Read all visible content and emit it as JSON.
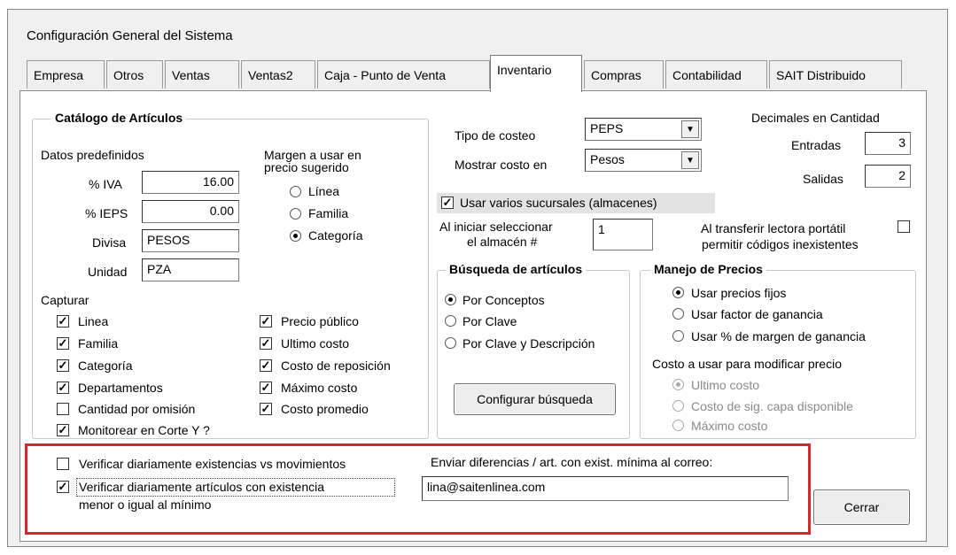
{
  "window": {
    "title": "Configuración General del Sistema"
  },
  "tabs": [
    {
      "label": "Empresa"
    },
    {
      "label": "Otros"
    },
    {
      "label": "Ventas"
    },
    {
      "label": "Ventas2"
    },
    {
      "label": "Caja - Punto de Venta"
    },
    {
      "label": "Inventario"
    },
    {
      "label": "Compras"
    },
    {
      "label": "Contabilidad"
    },
    {
      "label": "SAIT Distribuido"
    }
  ],
  "catalogo": {
    "title": "Catálogo de Artículos",
    "predef_title": "Datos predefinidos",
    "iva_label": "% IVA",
    "iva_value": "16.00",
    "ieps_label": "% IEPS",
    "ieps_value": "0.00",
    "divisa_label": "Divisa",
    "divisa_value": "PESOS",
    "unidad_label": "Unidad",
    "unidad_value": "PZA",
    "margen_title_1": "Margen a usar en",
    "margen_title_2": "precio sugerido",
    "margen_options": [
      {
        "label": "Línea",
        "checked": false
      },
      {
        "label": "Familia",
        "checked": false
      },
      {
        "label": "Categoría",
        "checked": true
      }
    ],
    "capturar_title": "Capturar",
    "capturar_left": [
      {
        "label": "Linea",
        "checked": true
      },
      {
        "label": "Familia",
        "checked": true
      },
      {
        "label": "Categoría",
        "checked": true
      },
      {
        "label": "Departamentos",
        "checked": true
      },
      {
        "label": "Cantidad por omisión",
        "checked": false
      },
      {
        "label": "Monitorear en Corte Y ?",
        "checked": true
      }
    ],
    "capturar_right": [
      {
        "label": "Precio público",
        "checked": true
      },
      {
        "label": "Ultimo costo",
        "checked": true
      },
      {
        "label": "Costo de reposición",
        "checked": true
      },
      {
        "label": "Máximo costo",
        "checked": true
      },
      {
        "label": "Costo promedio",
        "checked": true
      }
    ]
  },
  "costeo": {
    "tipo_label": "Tipo de costeo",
    "tipo_value": "PEPS",
    "mostrar_label": "Mostrar costo en",
    "mostrar_value": "Pesos"
  },
  "decimales": {
    "title": "Decimales en Cantidad",
    "entradas_label": "Entradas",
    "entradas_value": "3",
    "salidas_label": "Salidas",
    "salidas_value": "2"
  },
  "sucursales": {
    "label": "Usar varios sucursales (almacenes)",
    "checked": true
  },
  "almacen": {
    "label_1": "Al iniciar seleccionar",
    "label_2": "el almacén #",
    "value": "1"
  },
  "lectora": {
    "label_1": "Al transferir lectora portátil",
    "label_2": "permitir códigos inexistentes",
    "checked": false
  },
  "busqueda": {
    "title": "Búsqueda de artículos",
    "options": [
      {
        "label": "Por Conceptos",
        "checked": true
      },
      {
        "label": "Por Clave",
        "checked": false
      },
      {
        "label": "Por Clave y Descripción",
        "checked": false
      }
    ],
    "button": "Configurar búsqueda"
  },
  "precios": {
    "title": "Manejo de Precios",
    "options": [
      {
        "label": "Usar precios fijos",
        "checked": true
      },
      {
        "label": "Usar factor de ganancia",
        "checked": false
      },
      {
        "label": "Usar % de margen de ganancia",
        "checked": false
      }
    ],
    "costo_title": "Costo a usar para modificar precio",
    "costo_options": [
      {
        "label": "Ultimo costo",
        "checked": true
      },
      {
        "label": "Costo de sig. capa disponible",
        "checked": false
      },
      {
        "label": "Máximo costo",
        "checked": false
      }
    ]
  },
  "verificar": {
    "mov_label": "Verificar diariamente existencias vs movimientos",
    "mov_checked": false,
    "min_label_1": "Verificar diariamente artículos con existencia",
    "min_label_2": "menor o igual al mínimo",
    "min_checked": true,
    "correo_label": "Enviar diferencias / art. con exist. mínima al correo:",
    "correo_value": "lina@saitenlinea.com"
  },
  "buttons": {
    "cerrar": "Cerrar"
  },
  "colors": {
    "highlight": "#e0242b"
  }
}
